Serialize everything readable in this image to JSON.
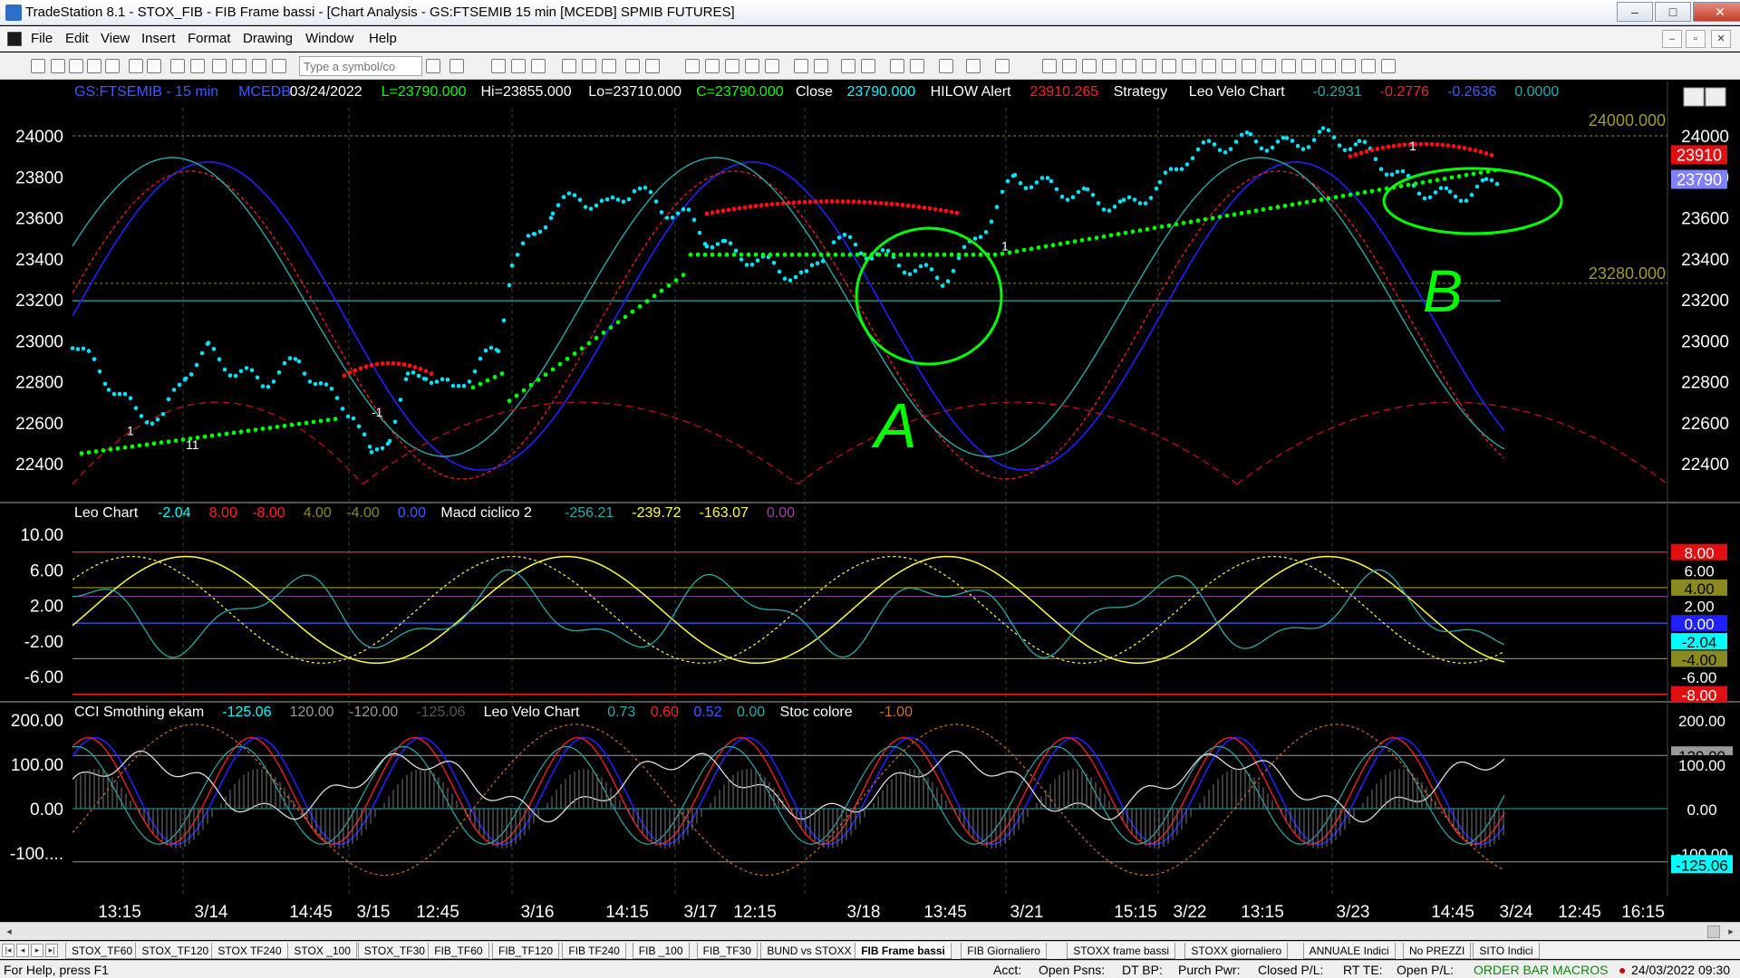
{
  "window": {
    "title": "TradeStation 8.1 - STOX_FIB - FIB Frame bassi - [Chart Analysis - GS:FTSEMIB  15 min  [MCEDB] SPMIB FUTURES]",
    "min_label": "–",
    "max_label": "□",
    "close_label": "✕"
  },
  "menu": {
    "items": [
      "File",
      "Edit",
      "View",
      "Insert",
      "Format",
      "Drawing",
      "Window",
      "Help"
    ],
    "mdi_buttons": [
      "–",
      "▫",
      "✕"
    ]
  },
  "toolbar": {
    "symbol_placeholder": "Type a symbol/co"
  },
  "price_panel": {
    "header": [
      {
        "text": "GS:FTSEMIB - 15 min",
        "color": "#3b5bff"
      },
      {
        "text": "MCEDB",
        "color": "#3b5bff"
      },
      {
        "text": "03/24/2022",
        "color": "#ffffff"
      },
      {
        "text": "L=23790.000",
        "color": "#00ff00"
      },
      {
        "text": "Hi=23855.000",
        "color": "#ffffff"
      },
      {
        "text": "Lo=23710.000",
        "color": "#ffffff"
      },
      {
        "text": "C=23790.000",
        "color": "#00ff00"
      },
      {
        "text": "Close",
        "color": "#ffffff"
      },
      {
        "text": "23790.000",
        "color": "#00ffff"
      },
      {
        "text": "HILOW Alert",
        "color": "#ffffff"
      },
      {
        "text": "23910.265",
        "color": "#ff2020"
      },
      {
        "text": "Strategy",
        "color": "#ffffff"
      },
      {
        "text": "Leo Velo Chart",
        "color": "#ffffff"
      },
      {
        "text": "-0.2931",
        "color": "#2aa9a9"
      },
      {
        "text": "-0.2776",
        "color": "#ff2020"
      },
      {
        "text": "-0.2636",
        "color": "#3b5bff"
      },
      {
        "text": "0.0000",
        "color": "#2aa9a9"
      }
    ],
    "y_ticks": [
      "24000",
      "23800",
      "23600",
      "23400",
      "23200",
      "23000",
      "22800",
      "22600",
      "22400"
    ],
    "level_labels": [
      "24000.000",
      "23280.000"
    ],
    "right_badges": [
      {
        "text": "23910",
        "bg": "#e01010",
        "fg": "#ffffff"
      },
      {
        "text": "23790",
        "bg": "#8080ff",
        "fg": "#ffffff"
      }
    ],
    "signal_labels": [
      "1",
      "11",
      "-1",
      "1",
      "1"
    ],
    "annotations": [
      "A",
      "B"
    ]
  },
  "leo_panel": {
    "header": [
      {
        "text": "Leo Chart",
        "color": "#ffffff"
      },
      {
        "text": "-2.04",
        "color": "#00ffff"
      },
      {
        "text": "8.00",
        "color": "#ff2020"
      },
      {
        "text": "-8.00",
        "color": "#ff2020"
      },
      {
        "text": "4.00",
        "color": "#8a8a20"
      },
      {
        "text": "-4.00",
        "color": "#8a8a20"
      },
      {
        "text": "0.00",
        "color": "#3b5bff"
      },
      {
        "text": "Macd ciclico 2",
        "color": "#ffffff"
      },
      {
        "text": "-256.21",
        "color": "#2aa9a9"
      },
      {
        "text": "-239.72",
        "color": "#ffff40"
      },
      {
        "text": "-163.07",
        "color": "#ffff40"
      },
      {
        "text": "0.00",
        "color": "#a040a0"
      }
    ],
    "y_ticks": [
      "10.00",
      "6.00",
      "2.00",
      "-2.00",
      "-6.00"
    ],
    "right_badges": [
      {
        "text": "8.00",
        "bg": "#e01010",
        "fg": "#ffffff"
      },
      {
        "text": "6.00",
        "bg": "#000000",
        "fg": "#ffffff"
      },
      {
        "text": "4.00",
        "bg": "#8a8a20",
        "fg": "#000000"
      },
      {
        "text": "2.00",
        "bg": "#000000",
        "fg": "#ffffff"
      },
      {
        "text": "0.00",
        "bg": "#2020ff",
        "fg": "#ffffff"
      },
      {
        "text": "-2.04",
        "bg": "#00ffff",
        "fg": "#000000"
      },
      {
        "text": "-4.00",
        "bg": "#8a8a20",
        "fg": "#000000"
      },
      {
        "text": "-6.00",
        "bg": "#000000",
        "fg": "#ffffff"
      },
      {
        "text": "-8.00",
        "bg": "#e01010",
        "fg": "#ffffff"
      }
    ]
  },
  "cci_panel": {
    "header": [
      {
        "text": "CCI Smothing ekam",
        "color": "#ffffff"
      },
      {
        "text": "-125.06",
        "color": "#00ffff"
      },
      {
        "text": "120.00",
        "color": "#9a9a9a"
      },
      {
        "text": "-120.00",
        "color": "#9a9a9a"
      },
      {
        "text": "-125.06",
        "color": "#555555"
      },
      {
        "text": "Leo Velo Chart",
        "color": "#ffffff"
      },
      {
        "text": "0.73",
        "color": "#2aa9a9"
      },
      {
        "text": "0.60",
        "color": "#ff2020"
      },
      {
        "text": "0.52",
        "color": "#3b5bff"
      },
      {
        "text": "0.00",
        "color": "#2aa9a9"
      },
      {
        "text": "Stoc colore",
        "color": "#ffffff"
      },
      {
        "text": "-1.00",
        "color": "#d07020"
      }
    ],
    "y_ticks": [
      "200.00",
      "100.00",
      "0.00",
      "-100...."
    ],
    "right_badges": [
      {
        "text": "200.00",
        "bg": "#000000",
        "fg": "#ffffff"
      },
      {
        "text": "120.00",
        "bg": "#9a9a9a",
        "fg": "#000000"
      },
      {
        "text": "100.00",
        "bg": "#000000",
        "fg": "#ffffff"
      },
      {
        "text": "0.00",
        "bg": "#000000",
        "fg": "#ffffff"
      },
      {
        "text": "-100.00",
        "bg": "#000000",
        "fg": "#ffffff"
      },
      {
        "text": "-125.06",
        "bg": "#00ffff",
        "fg": "#000000"
      }
    ]
  },
  "time_axis": [
    "13:15",
    "3/14",
    "14:45",
    "3/15",
    "12:45",
    "3/16",
    "14:15",
    "3/17",
    "12:15",
    "3/18",
    "13:45",
    "3/21",
    "15:15",
    "3/22",
    "13:15",
    "3/23",
    "14:45",
    "3/24",
    "12:45",
    "16:15"
  ],
  "tabs": [
    "STOX_TF60",
    "STOX_TF120",
    "STOX TF240",
    "STOX _100",
    "STOX_TF30",
    "FIB_TF60",
    "FIB_TF120",
    "FIB TF240",
    "FIB _100",
    "FIB_TF30",
    "BUND vs STOXX",
    "FIB Frame bassi",
    "FIB Giornaliero",
    "STOXX frame bassi",
    "STOXX giornaliero",
    "ANNUALE Indici",
    "No PREZZI",
    "SITO Indici"
  ],
  "active_tab": "FIB Frame bassi",
  "status": {
    "help": "For Help, press F1",
    "acct": "Acct:",
    "open_psns": "Open Psns:",
    "dt_bp": "DT BP:",
    "purch_pwr": "Purch Pwr:",
    "closed_pl": "Closed P/L:",
    "rt_te": "RT TE:",
    "open_pl": "Open P/L:",
    "order_bar": "ORDER BAR",
    "macros": "MACROS",
    "datetime": "24/03/2022 09:30"
  },
  "colors": {
    "price_dots": "#00e5ff",
    "green_dots": "#00ff00",
    "red_dots": "#ff1010",
    "teal": "#2aa9a9",
    "blue": "#2020ff",
    "red": "#ff2020",
    "yellow": "#ffff40",
    "hand_drawn": "#00ff00"
  }
}
